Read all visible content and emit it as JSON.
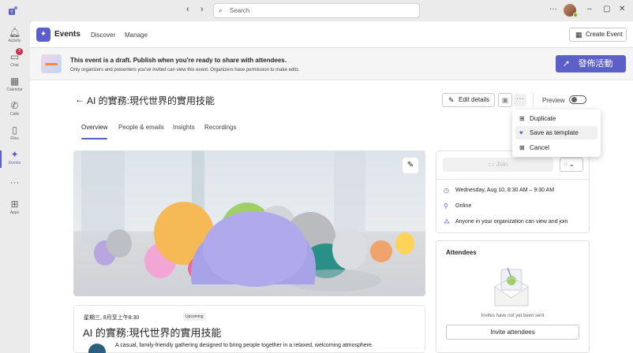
{
  "app": {
    "search_placeholder": "Search",
    "name": "Events",
    "tabs": [
      "Discover",
      "Manage"
    ],
    "create_label": "Create Event"
  },
  "rail": {
    "items": [
      {
        "label": "Activity",
        "icon": "bell-icon"
      },
      {
        "label": "Chat",
        "icon": "chat-icon",
        "badge": "2"
      },
      {
        "label": "Calendar",
        "icon": "calendar-icon"
      },
      {
        "label": "Calls",
        "icon": "phone-icon"
      },
      {
        "label": "Files",
        "icon": "file-icon"
      },
      {
        "label": "Events",
        "icon": "events-icon"
      },
      {
        "label": "",
        "icon": "more-icon"
      },
      {
        "label": "Apps",
        "icon": "apps-icon"
      }
    ]
  },
  "banner": {
    "title": "This event is a draft. Publish when you're ready to share with attendees.",
    "subtitle": "Only organizers and presenters you've invited can view this event. Organizers have permission to make edits.",
    "publish_label": "發佈活動"
  },
  "event": {
    "title": "AI 的實務:現代世界的實用技能",
    "edit_label": "Edit details",
    "preview_label": "Preview",
    "preview_on": false,
    "tabs": [
      "Overview",
      "People & emails",
      "Insights",
      "Recordings"
    ],
    "date_line": "星期三, 8月至上午8:30",
    "status": "Upcoming",
    "description": "A casual, family-friendly gathering designed to bring people together in a relaxed, welcoming atmosphere."
  },
  "menu": {
    "items": [
      {
        "label": "Duplicate",
        "icon": "duplicate-icon"
      },
      {
        "label": "Save as template",
        "icon": "heart-icon"
      },
      {
        "label": "Cancel",
        "icon": "cancel-icon"
      }
    ]
  },
  "side": {
    "join_label": "Join",
    "datetime": "Wednesday, Aug 10, 8:30 AM – 9:30 AM",
    "location": "Online",
    "access": "Anyone in your organization can view and join",
    "attendees_title": "Attendees",
    "no_invites": "Invites have not yet been sent",
    "invite_label": "Invite attendees"
  },
  "colors": {
    "accent": "#5b5fc7",
    "badge": "#c4314b"
  }
}
